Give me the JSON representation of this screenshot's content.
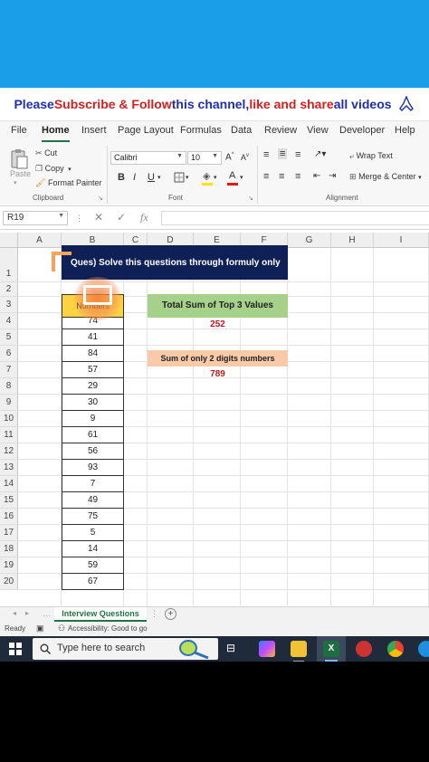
{
  "banner": {
    "part1": "Please ",
    "part2": "Subscribe & Follow",
    "part3": " this channel, ",
    "part4": "like and share",
    "part5": " all videos"
  },
  "ribbon": {
    "tabs": [
      "File",
      "Home",
      "Insert",
      "Page Layout",
      "Formulas",
      "Data",
      "Review",
      "View",
      "Developer",
      "Help"
    ],
    "active_tab": "Home",
    "clipboard": {
      "paste": "Paste",
      "cut": "Cut",
      "copy": "Copy",
      "format_painter": "Format Painter",
      "label": "Clipboard"
    },
    "font": {
      "name": "Calibri",
      "size": "10",
      "bold": "B",
      "italic": "I",
      "underline": "U",
      "label": "Font"
    },
    "alignment": {
      "wrap_text": "Wrap Text",
      "merge_center": "Merge & Center",
      "label": "Alignment"
    }
  },
  "formula_bar": {
    "name_box": "R19",
    "fx": "fx",
    "formula": ""
  },
  "sheet": {
    "columns": [
      "A",
      "B",
      "C",
      "D",
      "E",
      "F",
      "G",
      "H",
      "I"
    ],
    "rows": [
      "1",
      "2",
      "3",
      "4",
      "5",
      "6",
      "7",
      "8",
      "9",
      "10",
      "11",
      "12",
      "13",
      "14",
      "15",
      "16",
      "17",
      "18",
      "19",
      "20"
    ],
    "title": "Ques) Solve this questions through formuly only",
    "numbers_header": "Numbers",
    "numbers": [
      "74",
      "41",
      "84",
      "57",
      "29",
      "30",
      "9",
      "61",
      "56",
      "93",
      "7",
      "49",
      "75",
      "5",
      "14",
      "59",
      "67"
    ],
    "top3_label": "Total Sum of Top 3 Values",
    "top3_value": "252",
    "two_digit_label": "Sum of only 2 digits numbers",
    "two_digit_value": "789"
  },
  "sheet_tab": {
    "name": "Interview Questions"
  },
  "status": {
    "ready": "Ready",
    "accessibility": "Accessibility: Good to go"
  },
  "taskbar": {
    "search_placeholder": "Type here to search"
  },
  "colors": {
    "excel_green": "#217346",
    "title_navy": "#0f2057",
    "header_yellow": "#ffd23f",
    "green_label": "#a5d18a",
    "peach_label": "#f8caa8",
    "red_value": "#b51c1c"
  }
}
